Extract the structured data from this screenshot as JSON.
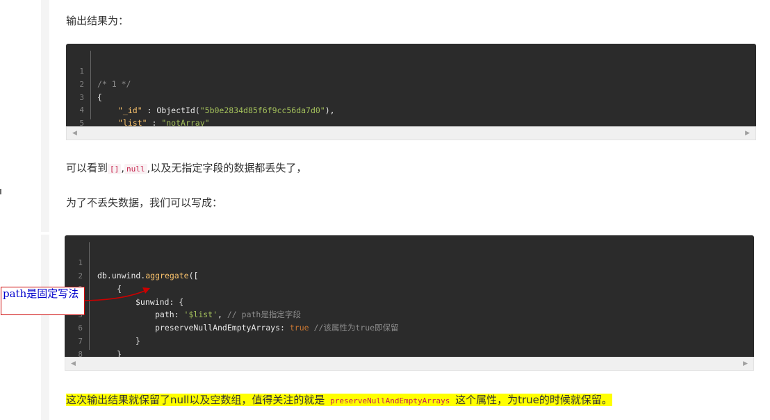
{
  "para_output": "输出结果为：",
  "code1": {
    "lines": [
      {
        "n": "1",
        "text": "/* 1 */"
      },
      {
        "n": "2",
        "text": "{"
      },
      {
        "n": "3",
        "key": "\"_id\"",
        "sep": " : ",
        "pre": "ObjectId(",
        "str": "\"5b0e2834d85f6f9cc56da7d0\"",
        "post": "),"
      },
      {
        "n": "4",
        "key": "\"list\"",
        "sep": " : ",
        "str": "\"notArray\""
      },
      {
        "n": "5",
        "text": "}"
      }
    ]
  },
  "para_lost": {
    "prefix": "可以看到",
    "code_a": "[]",
    "comma": ",",
    "code_b": "null",
    "suffix": ",以及无指定字段的数据都丢失了，"
  },
  "para_write": "为了不丢失数据，我们可以写成：",
  "code2": {
    "lines": [
      {
        "n": "1",
        "a": "db.unwind.",
        "fn": "aggregate",
        "b": "(["
      },
      {
        "n": "2",
        "a": "{"
      },
      {
        "n": "3",
        "a": "$unwind: {"
      },
      {
        "n": "4",
        "a": "path: ",
        "str": "'$list'",
        "b": ", ",
        "comment": "// path是指定字段"
      },
      {
        "n": "5",
        "a": "preserveNullAndEmptyArrays: ",
        "kw": "true",
        "b": " ",
        "comment": "//该属性为true即保留"
      },
      {
        "n": "6",
        "a": "}"
      },
      {
        "n": "7",
        "a": "}"
      },
      {
        "n": "8",
        "a": "])"
      }
    ]
  },
  "annotation": "path是固定写法",
  "para_final": {
    "prefix": "这次输出结果就保留了null以及空数组，值得关注的就是 ",
    "code": "preserveNullAndEmptyArrays",
    "suffix": " 这个属性，为true的时候就保留。"
  },
  "colors": {
    "code_bg": "#2b2b2b",
    "annotation_border": "#cc0000",
    "annotation_text": "#0000cc",
    "highlight": "#ffff00"
  }
}
